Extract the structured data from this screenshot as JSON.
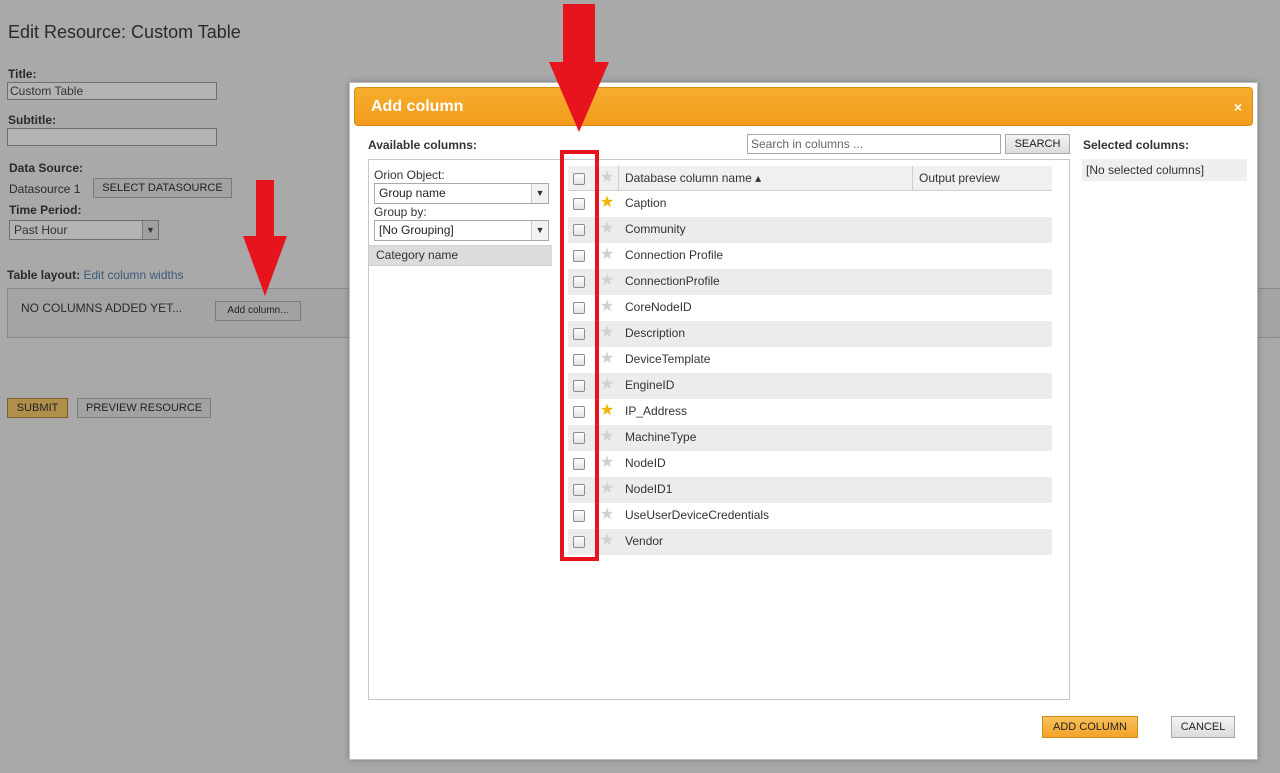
{
  "page": {
    "title": "Edit Resource: Custom Table",
    "title_label": "Title:",
    "title_value": "Custom Table",
    "subtitle_label": "Subtitle:",
    "subtitle_value": "",
    "datasource_label": "Data Source:",
    "datasource_value": "Datasource 1",
    "select_datasource": "SELECT DATASOURCE",
    "time_period_label": "Time Period:",
    "time_period_value": "Past Hour",
    "table_layout_label": "Table layout:",
    "edit_widths_link": "Edit column widths",
    "no_columns_text": "NO COLUMNS ADDED YET...",
    "add_column_btn": "Add column...",
    "submit": "SUBMIT",
    "preview": "PREVIEW RESOURCE"
  },
  "modal": {
    "title": "Add column",
    "close": "×",
    "available_label": "Available columns:",
    "selected_label": "Selected columns:",
    "search_placeholder": "Search in columns ...",
    "search_btn": "SEARCH",
    "orion_object_label": "Orion Object:",
    "orion_object_value": "Group name",
    "group_by_label": "Group by:",
    "group_by_value": "[No Grouping]",
    "category_header": "Category name",
    "col_db": "Database column name ▴",
    "col_output": "Output preview",
    "selected_empty": "[No selected columns]",
    "rows": [
      {
        "name": "Caption",
        "fav": true
      },
      {
        "name": "Community",
        "fav": false
      },
      {
        "name": "Connection Profile",
        "fav": false
      },
      {
        "name": "ConnectionProfile",
        "fav": false
      },
      {
        "name": "CoreNodeID",
        "fav": false
      },
      {
        "name": "Description",
        "fav": false
      },
      {
        "name": "DeviceTemplate",
        "fav": false
      },
      {
        "name": "EngineID",
        "fav": false
      },
      {
        "name": "IP_Address",
        "fav": true
      },
      {
        "name": "MachineType",
        "fav": false
      },
      {
        "name": "NodeID",
        "fav": false
      },
      {
        "name": "NodeID1",
        "fav": false
      },
      {
        "name": "UseUserDeviceCredentials",
        "fav": false
      },
      {
        "name": "Vendor",
        "fav": false
      }
    ],
    "add_column": "ADD COLUMN",
    "cancel": "CANCEL"
  },
  "colors": {
    "accent": "#f39c1c",
    "annotation": "#e8141d",
    "favorite_star": "#f0b400"
  }
}
